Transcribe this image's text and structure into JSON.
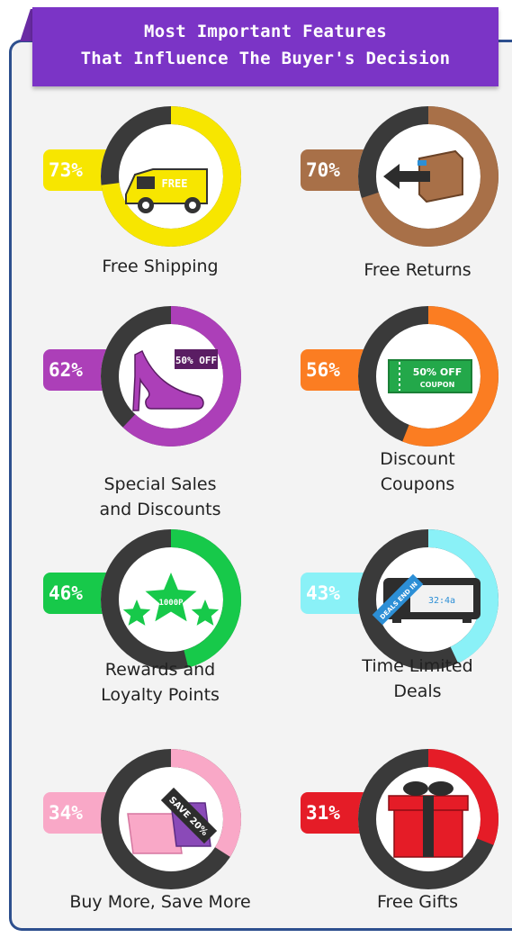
{
  "header": {
    "line1": "Most Important Features",
    "line2": "That Influence The Buyer's Decision"
  },
  "colors": {
    "banner": "#7b34c6",
    "ring_track": "#3a3a3a",
    "frame": "#2d4f8e"
  },
  "chart_data": {
    "type": "pie",
    "title": "Most Important Features That Influence The Buyer's Decision",
    "unit": "%",
    "categories": [
      "Free Shipping",
      "Free Returns",
      "Special Sales and Discounts",
      "Discount Coupons",
      "Rewards and Loyalty Points",
      "Time Limited Deals",
      "Buy More, Save More",
      "Free Gifts"
    ],
    "values": [
      73,
      70,
      62,
      56,
      46,
      43,
      34,
      31
    ],
    "features": [
      {
        "id": "free-shipping",
        "percent": 73,
        "percent_label": "73%",
        "label_lines": [
          "Free Shipping"
        ],
        "color": "#f7e600",
        "icon": "van-icon",
        "icon_text": "FREE"
      },
      {
        "id": "free-returns",
        "percent": 70,
        "percent_label": "70%",
        "label_lines": [
          "Free Returns"
        ],
        "color": "#a87048",
        "icon": "return-box-icon",
        "icon_text": ""
      },
      {
        "id": "special-sales",
        "percent": 62,
        "percent_label": "62%",
        "label_lines": [
          "Special Sales",
          "and Discounts"
        ],
        "color": "#ac3fb8",
        "icon": "high-heel-icon",
        "icon_text": "50% OFF"
      },
      {
        "id": "discount-coupons",
        "percent": 56,
        "percent_label": "56%",
        "label_lines": [
          "Discount",
          "Coupons"
        ],
        "color": "#fb7d22",
        "icon": "coupon-icon",
        "icon_text": "50% OFF COUPON"
      },
      {
        "id": "rewards",
        "percent": 46,
        "percent_label": "46%",
        "label_lines": [
          "Rewards and",
          "Loyalty Points"
        ],
        "color": "#17c94a",
        "icon": "stars-icon",
        "icon_text": "1000P"
      },
      {
        "id": "time-limited",
        "percent": 43,
        "percent_label": "43%",
        "label_lines": [
          "Time Limited",
          "Deals"
        ],
        "color": "#8af1f7",
        "icon": "clock-icon",
        "icon_text": "DEALS END IN 32:4a"
      },
      {
        "id": "buy-more",
        "percent": 34,
        "percent_label": "34%",
        "label_lines": [
          "Buy More, Save More"
        ],
        "color": "#f9a8c7",
        "icon": "shopping-bags-icon",
        "icon_text": "SAVE 20%"
      },
      {
        "id": "free-gifts",
        "percent": 31,
        "percent_label": "31%",
        "label_lines": [
          "Free Gifts"
        ],
        "color": "#e51c27",
        "icon": "gift-icon",
        "icon_text": ""
      }
    ]
  }
}
